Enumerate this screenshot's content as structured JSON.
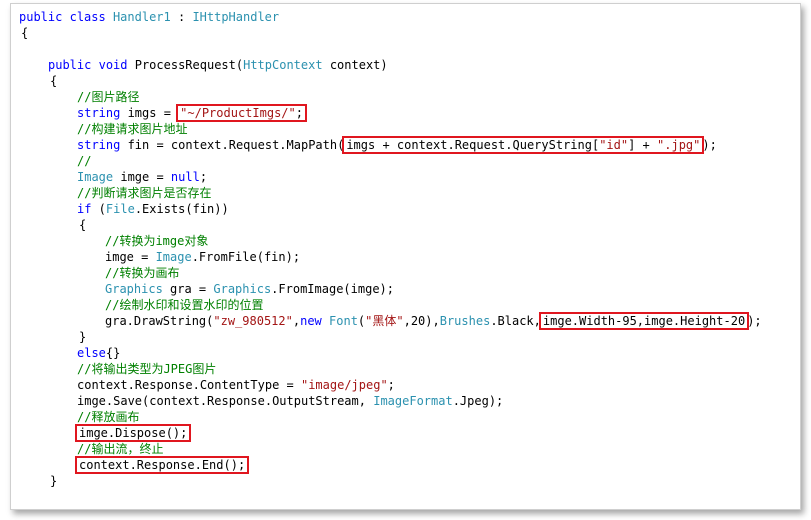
{
  "lines": {
    "l1": {
      "kw1": "public",
      "kw2": "class",
      "type": "Handler1",
      "sep": " : ",
      "iface": "IHttpHandler"
    },
    "l2": {
      "text": "{"
    },
    "l3": {
      "kw1": "public",
      "kw2": "void",
      "name": "ProcessRequest(",
      "type": "HttpContext",
      "rest": " context)"
    },
    "l4": {
      "text": "{"
    },
    "l5": {
      "comment": "//图片路径"
    },
    "l6": {
      "kw": "string",
      "mid": " imgs = ",
      "str": "\"~/ProductImgs/\"",
      "end": ";"
    },
    "l7": {
      "comment": "//构建请求图片地址"
    },
    "l8": {
      "kw": "string",
      "mid": " fin = context.Request.MapPath(",
      "hlpre": "imgs + context.Request.QueryString[",
      "s1": "\"id\"",
      "mid2": "] + ",
      "s2": "\".jpg\"",
      "end": ");"
    },
    "l9": {
      "comment": "//"
    },
    "l10": {
      "type": "Image",
      "mid": " imge = ",
      "kw": "null",
      "end": ";"
    },
    "l11": {
      "comment": "//判断请求图片是否存在"
    },
    "l12": {
      "kw": "if",
      "mid": " (",
      "type": "File",
      "end": ".Exists(fin))"
    },
    "l13": {
      "text": "{"
    },
    "l14": {
      "comment": "//转换为imge对象"
    },
    "l15": {
      "mid": "imge = ",
      "type": "Image",
      "end": ".FromFile(fin);"
    },
    "l16": {
      "comment": "//转换为画布"
    },
    "l17": {
      "type": "Graphics",
      "mid": " gra = ",
      "type2": "Graphics",
      "end": ".FromImage(imge);"
    },
    "l18": {
      "comment": "//绘制水印和设置水印的位置"
    },
    "l19": {
      "pre": "gra.DrawString(",
      "s1": "\"zw_980512\"",
      "c1": ",",
      "kw": "new",
      "sp": " ",
      "type": "Font",
      "p2": "(",
      "s2": "\"黑体\"",
      "mid": ",20),",
      "type2": "Brushes",
      "mid2": ".Black,",
      "hl": "imge.Width-95,imge.Height-20",
      "end": ");"
    },
    "l20": {
      "text": "}"
    },
    "l21": {
      "kw": "else",
      "end": "{}"
    },
    "l22": {
      "comment": "//将输出类型为JPEG图片"
    },
    "l23": {
      "mid": "context.Response.ContentType = ",
      "str": "\"image/jpeg\"",
      "end": ";"
    },
    "l24": {
      "mid": "imge.Save(context.Response.OutputStream, ",
      "type": "ImageFormat",
      "end": ".Jpeg);"
    },
    "l25": {
      "comment": "//释放画布"
    },
    "l26": {
      "hl": "imge.Dispose();"
    },
    "l27": {
      "comment": "//输出流，终止"
    },
    "l28": {
      "hl": "context.Response.End();"
    },
    "l29": {
      "text": "}"
    }
  },
  "colors": {
    "keyword": "#0000ff",
    "type": "#2b91af",
    "string": "#a31515",
    "comment": "#008000",
    "highlight": "#e0161f"
  }
}
